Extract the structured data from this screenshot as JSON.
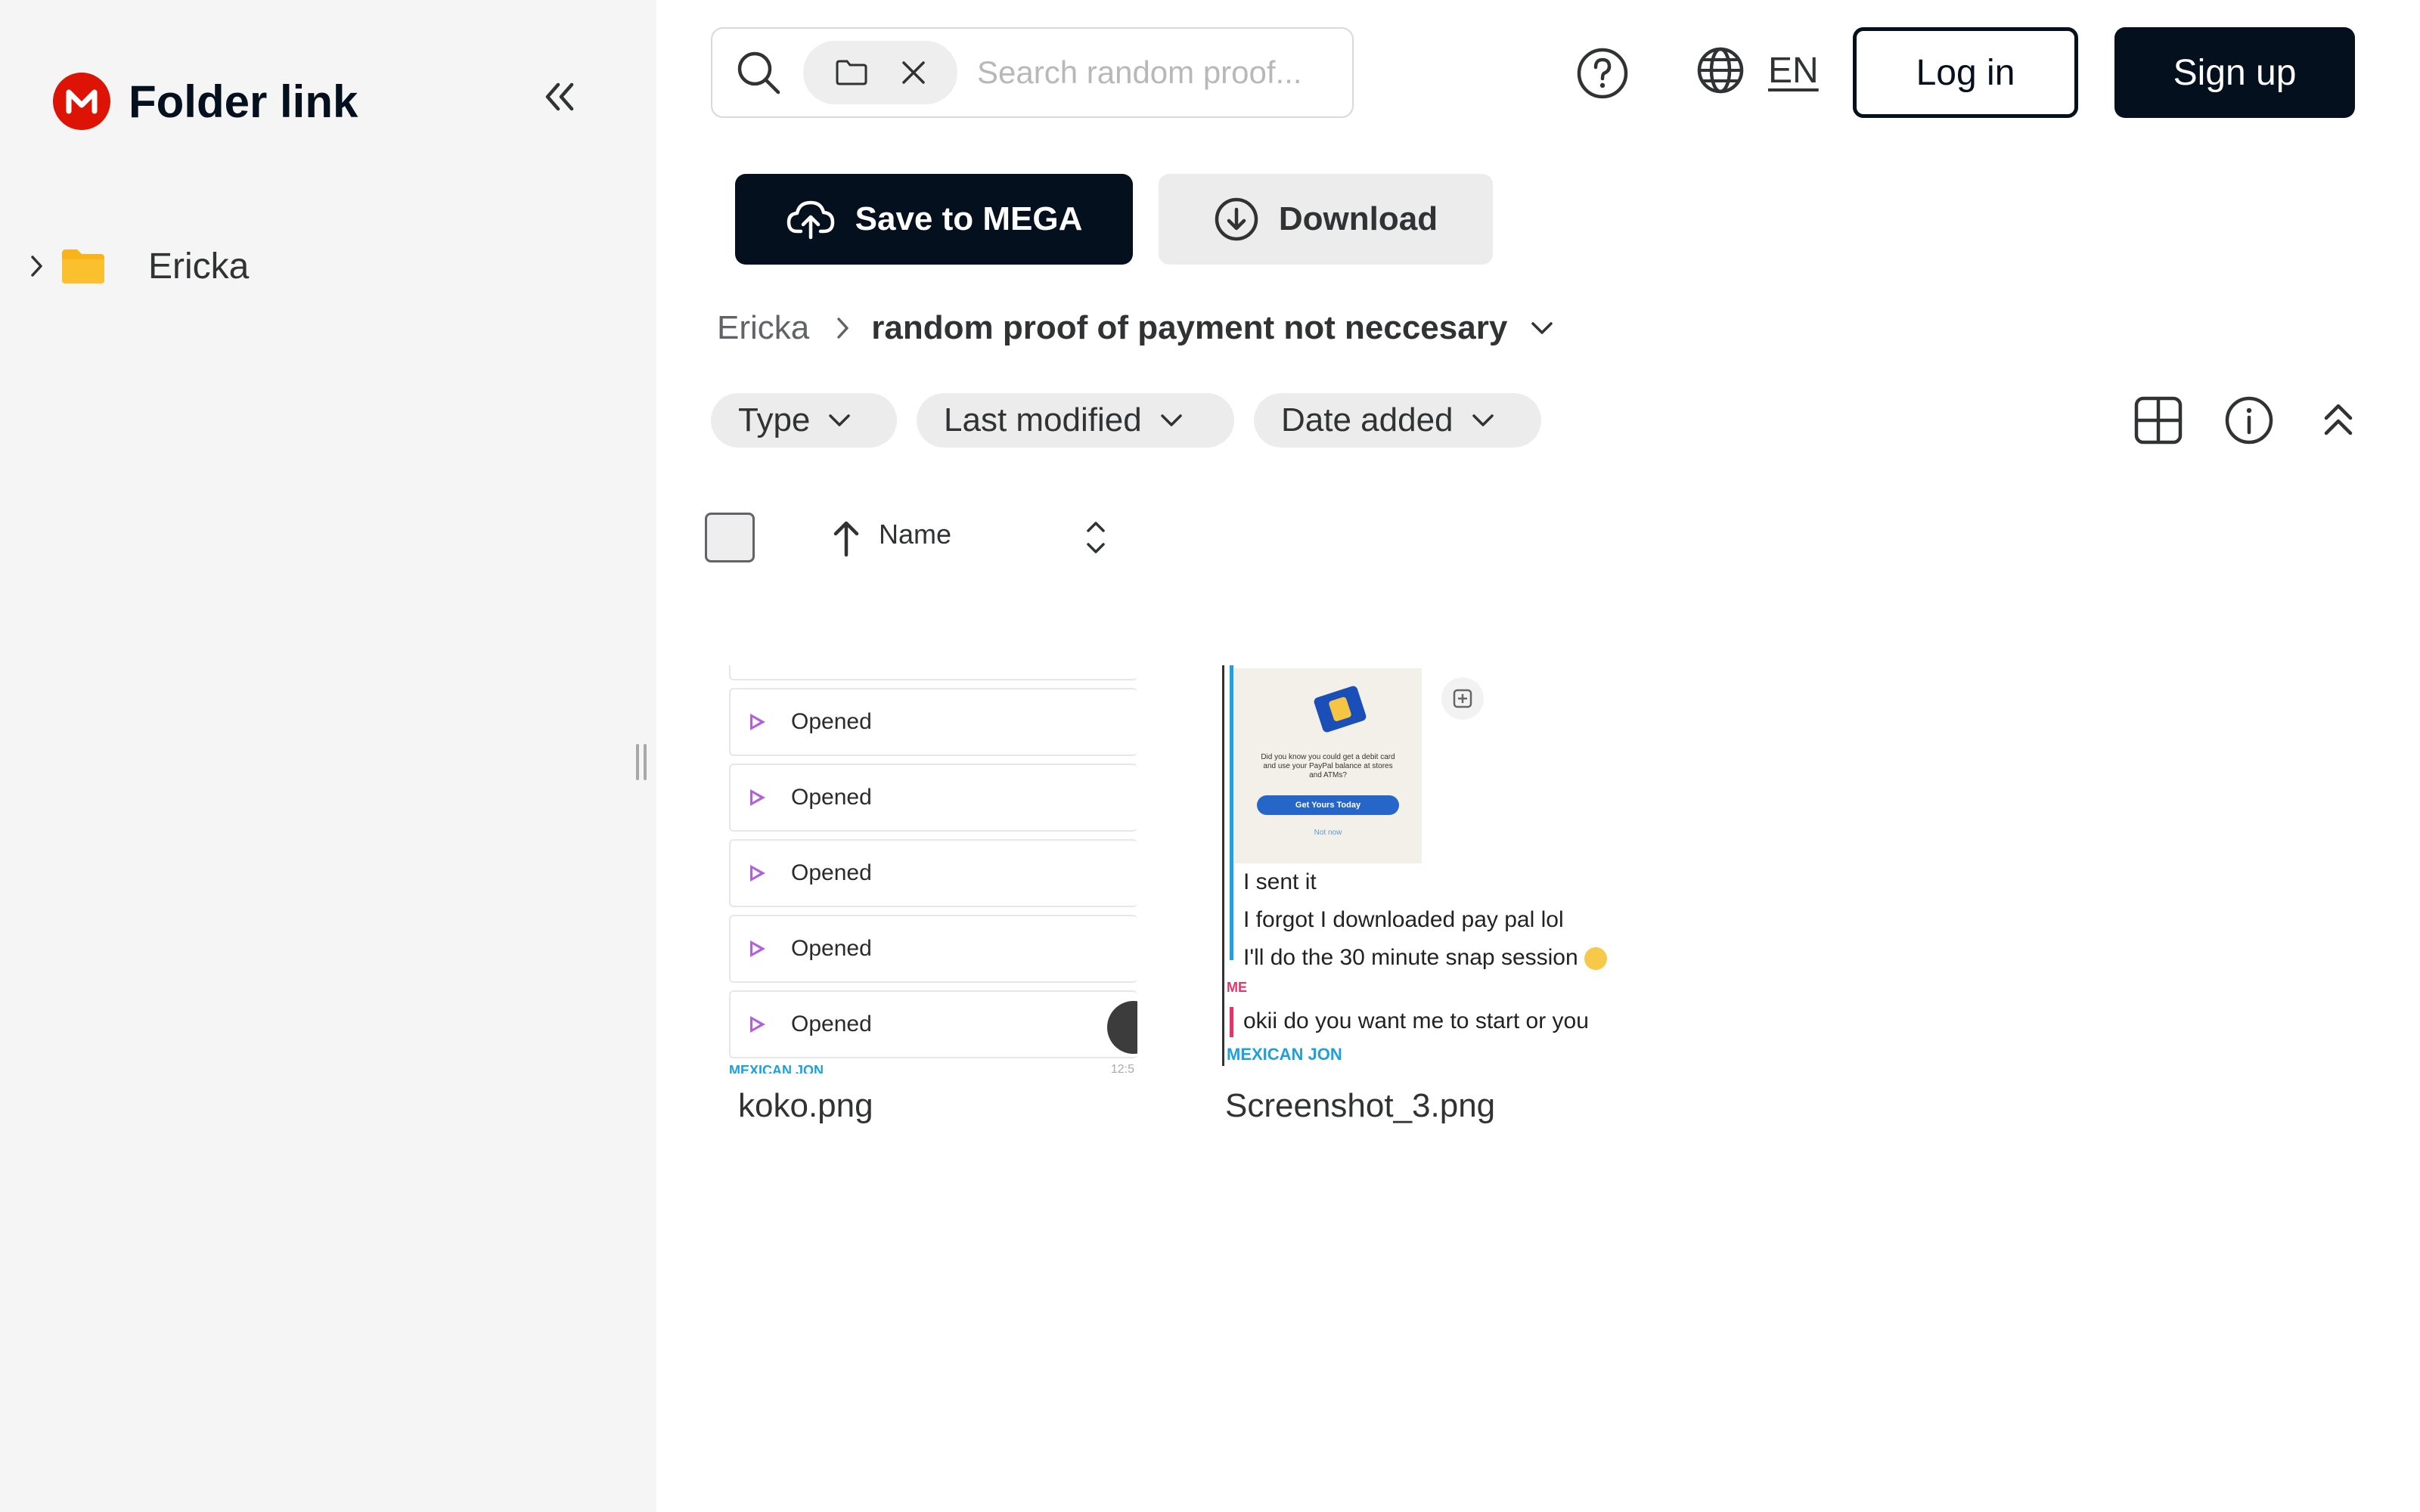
{
  "sidebar": {
    "title": "Folder link",
    "tree": [
      {
        "label": "Ericka"
      }
    ]
  },
  "search": {
    "placeholder": "Search random proof..."
  },
  "header": {
    "language": "EN",
    "login_label": "Log in",
    "signup_label": "Sign up"
  },
  "actions": {
    "save_label": "Save to MEGA",
    "download_label": "Download"
  },
  "breadcrumb": {
    "parent": "Ericka",
    "current": "random proof of payment not neccesary"
  },
  "filters": [
    {
      "label": "Type"
    },
    {
      "label": "Last modified"
    },
    {
      "label": "Date added"
    }
  ],
  "sort": {
    "label": "Name"
  },
  "files": [
    {
      "name": "koko.png",
      "thumb": {
        "rows": [
          "Opened",
          "Opened",
          "Opened",
          "Opened",
          "Opened"
        ],
        "footer": "MEXICAN JON",
        "time": "12:5"
      }
    },
    {
      "name": "Screenshot_3.png",
      "thumb": {
        "card_text": "Did you know you could get a debit card and use your PayPal balance at stores and ATMs?",
        "card_button": "Get Yours Today",
        "card_link": "Not now",
        "lines": [
          "I sent it",
          "I forgot I downloaded pay pal lol",
          "I'll do the 30 minute snap session"
        ],
        "sender_me": "ME",
        "reply": "okii do you want me to start or you",
        "footer": "MEXICAN JON"
      }
    }
  ],
  "colors": {
    "brand": "#dd1405",
    "primary": "#04101e",
    "folder": "#f8b41a",
    "sidebar_bg": "#f5f5f5",
    "chip_bg": "#ececec"
  },
  "icons": {
    "logo": "mega-logo-icon",
    "collapse": "double-chevron-left-icon",
    "search": "search-icon",
    "help": "help-icon",
    "language": "globe-icon",
    "save": "cloud-upload-icon",
    "download": "download-icon",
    "grid": "grid-view-icon",
    "info": "info-icon",
    "collapse_header": "double-chevron-up-icon"
  }
}
